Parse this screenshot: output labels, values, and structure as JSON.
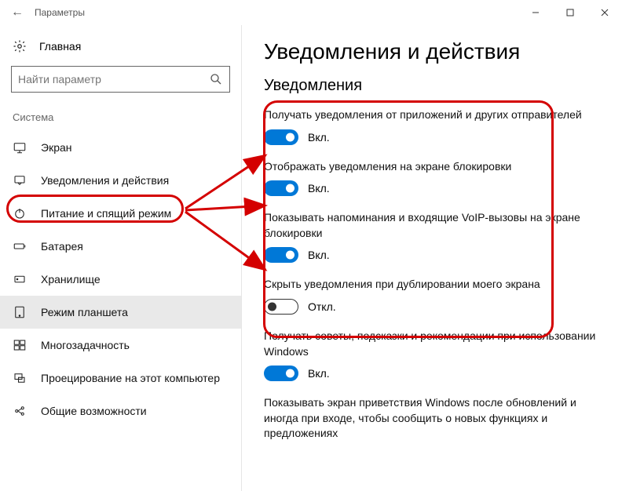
{
  "window": {
    "title": "Параметры"
  },
  "sidebar": {
    "home": "Главная",
    "search_placeholder": "Найти параметр",
    "category": "Система",
    "items": [
      {
        "label": "Экран"
      },
      {
        "label": "Уведомления и действия"
      },
      {
        "label": "Питание и спящий режим"
      },
      {
        "label": "Батарея"
      },
      {
        "label": "Хранилище"
      },
      {
        "label": "Режим планшета"
      },
      {
        "label": "Многозадачность"
      },
      {
        "label": "Проецирование на этот компьютер"
      },
      {
        "label": "Общие возможности"
      }
    ]
  },
  "main": {
    "title": "Уведомления и действия",
    "subtitle": "Уведомления",
    "settings": [
      {
        "label": "Получать уведомления от приложений и других отправителей",
        "state": "Вкл.",
        "on": true
      },
      {
        "label": "Отображать уведомления на экране блокировки",
        "state": "Вкл.",
        "on": true
      },
      {
        "label": "Показывать напоминания и входящие VoIP-вызовы на экране блокировки",
        "state": "Вкл.",
        "on": true
      },
      {
        "label": "Скрыть уведомления при дублировании моего экрана",
        "state": "Откл.",
        "on": false
      },
      {
        "label": "Получать советы, подсказки и рекомендации при использовании Windows",
        "state": "Вкл.",
        "on": true
      },
      {
        "label": "Показывать экран приветствия Windows после обновлений и иногда при входе, чтобы сообщить о новых функциях и предложениях",
        "state": "",
        "on": null
      }
    ]
  },
  "colors": {
    "accent": "#0078d7",
    "annotation": "#d40000"
  }
}
